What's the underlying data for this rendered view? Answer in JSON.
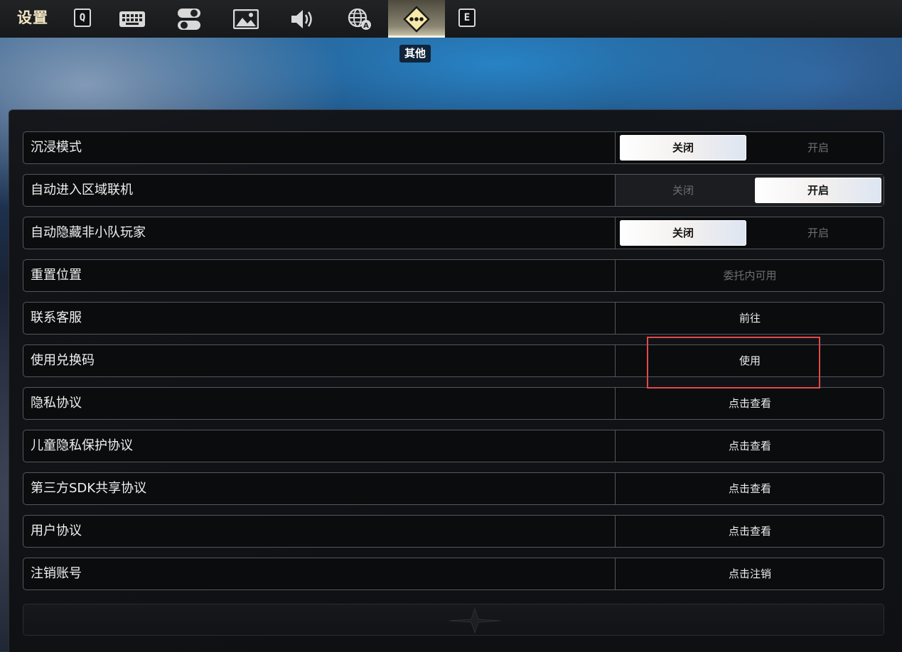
{
  "header": {
    "title": "设置",
    "key_left": "Q",
    "key_right": "E",
    "tabs": [
      {
        "name": "keyboard",
        "icon": "keyboard-icon"
      },
      {
        "name": "toggles",
        "icon": "toggle-icon"
      },
      {
        "name": "graphics",
        "icon": "image-icon"
      },
      {
        "name": "audio",
        "icon": "speaker-icon"
      },
      {
        "name": "language",
        "icon": "globe-icon"
      },
      {
        "name": "other",
        "icon": "diamond-dots-icon",
        "active": true
      }
    ],
    "active_tab_label": "其他"
  },
  "settings": {
    "immersive": {
      "label": "沉浸模式",
      "off": "关闭",
      "on": "开启",
      "value": "off"
    },
    "auto_region": {
      "label": "自动进入区域联机",
      "off": "关闭",
      "on": "开启",
      "value": "on"
    },
    "auto_hide": {
      "label": "自动隐藏非小队玩家",
      "off": "关闭",
      "on": "开启",
      "value": "off"
    },
    "reset_position": {
      "label": "重置位置",
      "action": "委托内可用",
      "enabled": false
    },
    "contact_support": {
      "label": "联系客服",
      "action": "前往"
    },
    "redeem_code": {
      "label": "使用兑换码",
      "action": "使用"
    },
    "privacy_policy": {
      "label": "隐私协议",
      "action": "点击查看"
    },
    "child_privacy": {
      "label": "儿童隐私保护协议",
      "action": "点击查看"
    },
    "third_party_sdk": {
      "label": "第三方SDK共享协议",
      "action": "点击查看"
    },
    "user_agreement": {
      "label": "用户协议",
      "action": "点击查看"
    },
    "delete_account": {
      "label": "注销账号",
      "action": "点击注销"
    }
  },
  "colors": {
    "accent_title": "#f3e7c4",
    "highlight_box": "#e24a4a",
    "toggle_on": "#ffffff",
    "row_border": "#54575c"
  }
}
